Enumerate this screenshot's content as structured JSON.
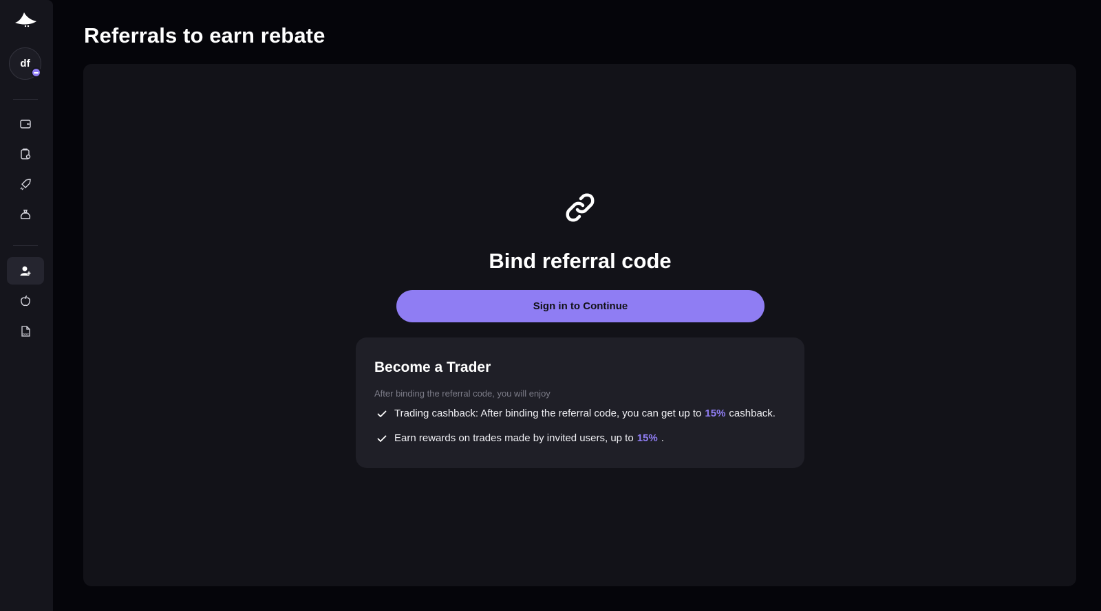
{
  "user": {
    "initials": "df"
  },
  "page": {
    "title": "Referrals to earn rebate"
  },
  "sidebar": {
    "items": [
      {
        "icon": "wallet-icon"
      },
      {
        "icon": "clipboard-icon"
      },
      {
        "icon": "rocket-icon"
      },
      {
        "icon": "money-bag-icon"
      },
      {
        "icon": "user-plus-icon",
        "active": true
      },
      {
        "icon": "apple-icon"
      },
      {
        "icon": "doc-file-icon"
      }
    ]
  },
  "bind": {
    "title": "Bind referral code",
    "button_label": "Sign in to Continue"
  },
  "trader_card": {
    "title": "Become a Trader",
    "subtitle": "After binding the referral code, you will enjoy",
    "benefits": [
      {
        "before": "Trading cashback: After binding the referral code, you can get up to",
        "highlight": "15%",
        "after": "cashback."
      },
      {
        "before": "Earn rewards on trades made by invited users, up to",
        "highlight": "15%",
        "after": "."
      }
    ]
  },
  "colors": {
    "accent": "#8f7df3",
    "background": "#05050a",
    "panel": "#121218",
    "card": "#1f1f27",
    "sidebar": "#15151c"
  }
}
